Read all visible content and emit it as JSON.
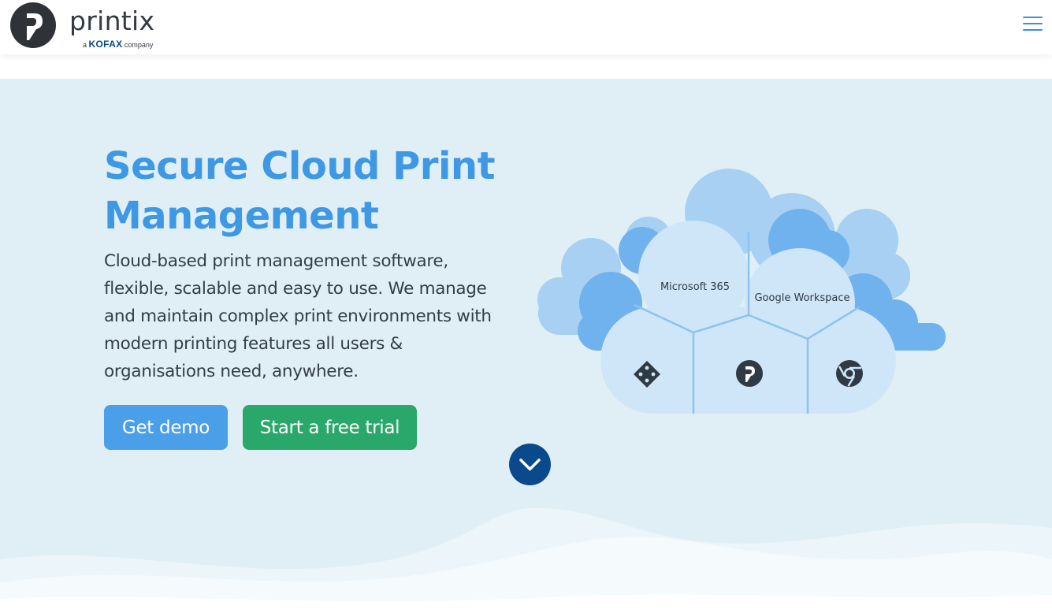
{
  "header": {
    "brand": "printix",
    "tagline_prefix": "a",
    "tagline_brand": "KOFAX",
    "tagline_suffix": "company",
    "menu_icon": "hamburger-menu-icon"
  },
  "hero": {
    "title": "Secure Cloud Print Management",
    "description": "Cloud-based print management software, flexible, scalable and easy to use. We manage and maintain complex print environments with modern printing features all users & organisations need, anywhere.",
    "buttons": {
      "demo_label": "Get demo",
      "trial_label": "Start a free trial"
    },
    "scroll_icon": "chevron-down-icon"
  },
  "illustration": {
    "segments": {
      "microsoft": "Microsoft 365",
      "google": "Google Workspace"
    },
    "icons": [
      "network-icon",
      "printix-icon",
      "chrome-icon"
    ]
  },
  "colors": {
    "accent_blue": "#3e98e4",
    "button_blue": "#4a9fe8",
    "button_green": "#2aa86c",
    "dark_navy": "#0a4a8c",
    "hero_bg": "#e0eff6"
  }
}
